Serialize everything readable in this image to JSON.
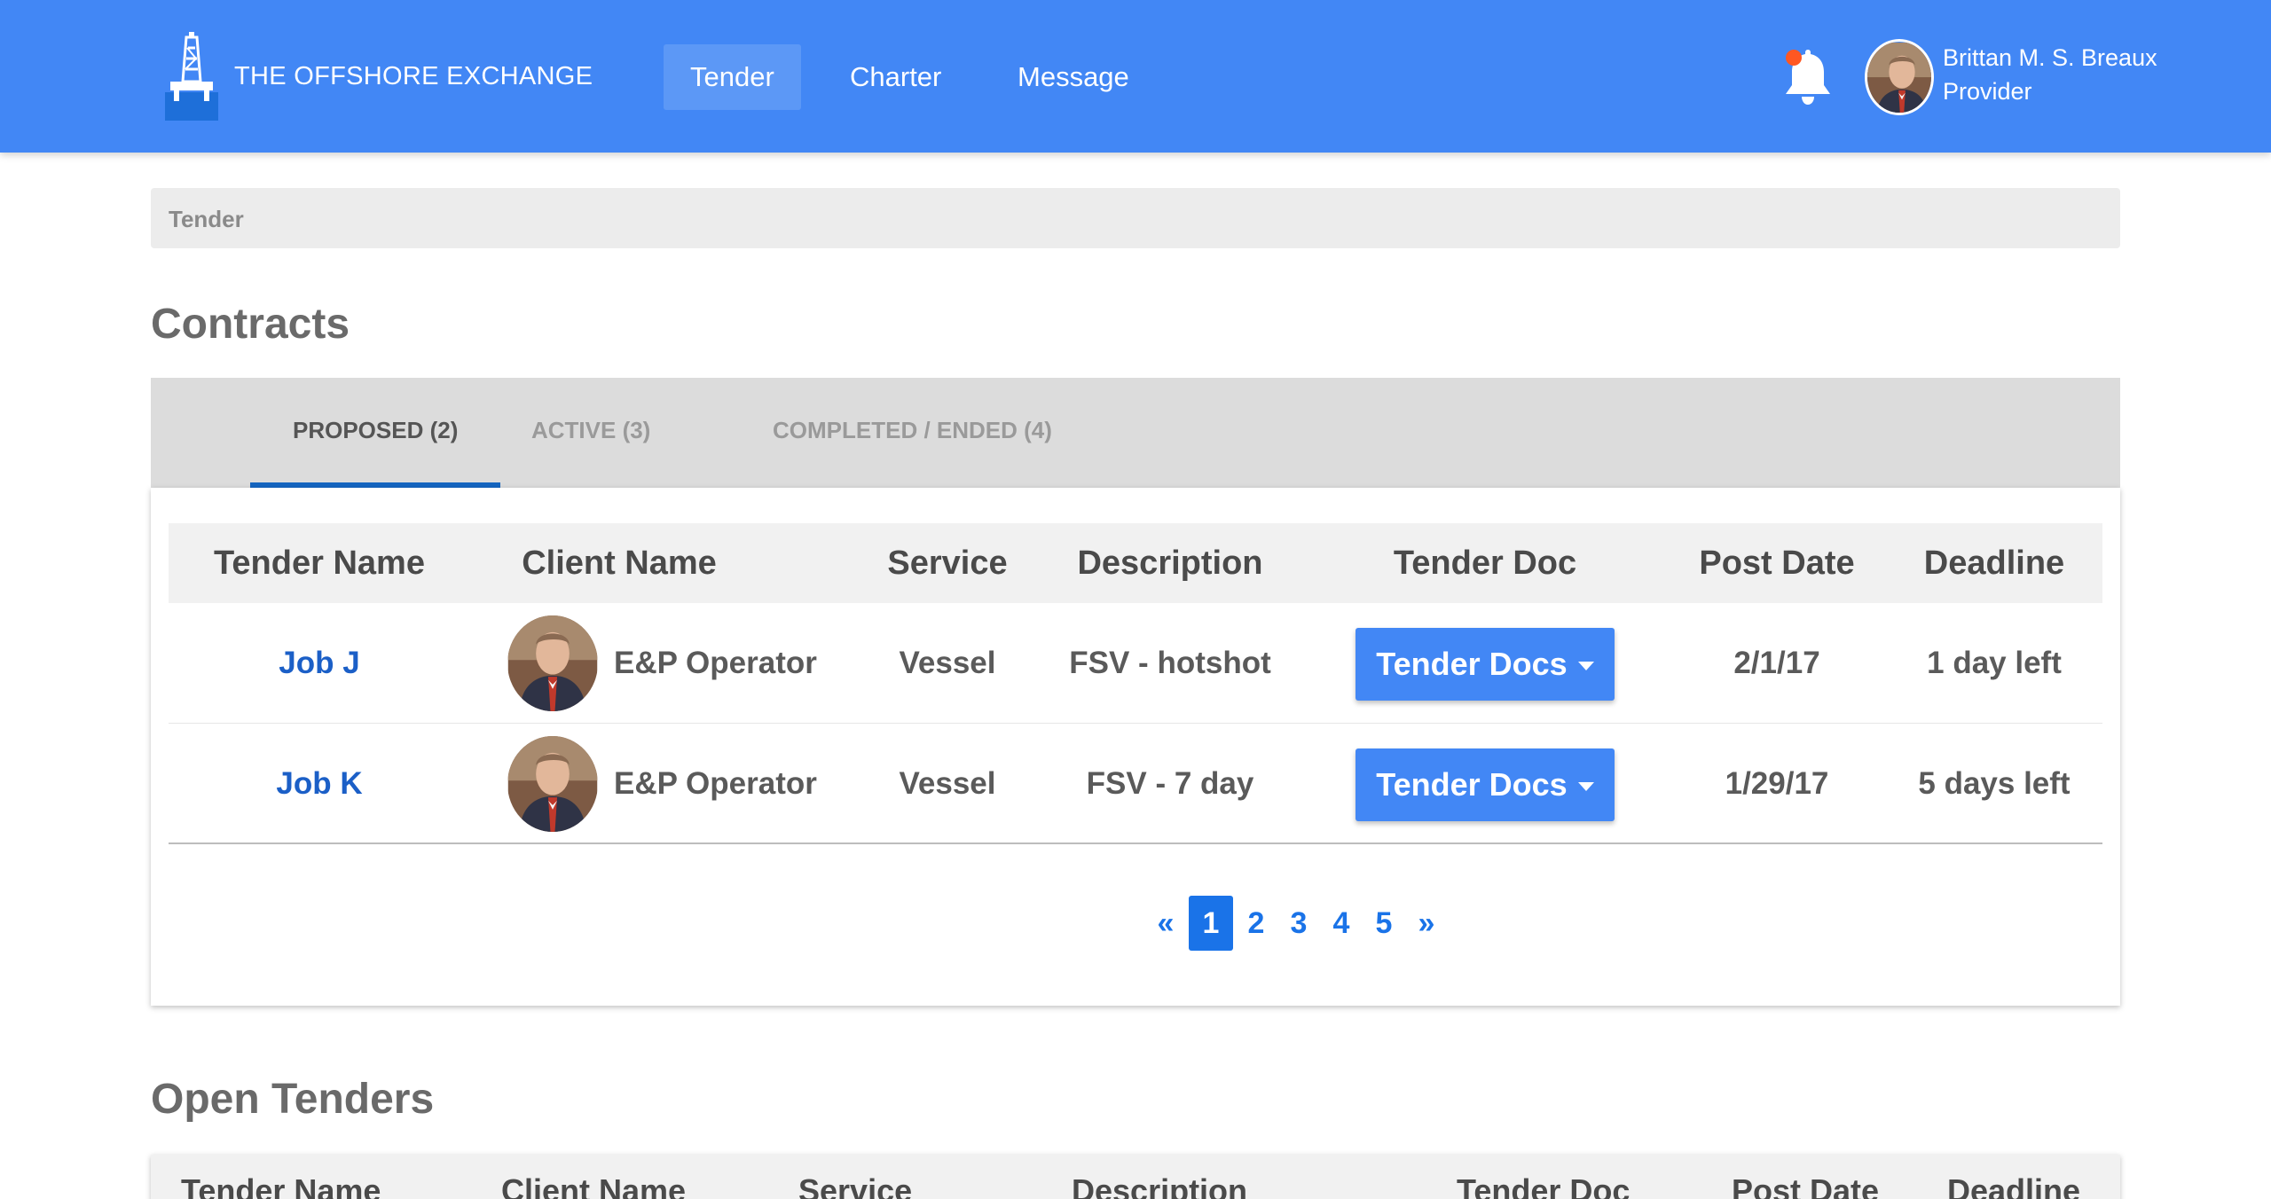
{
  "brand": {
    "name": "THE OFFSHORE EXCHANGE",
    "logo_icon": "oil-rig-icon"
  },
  "nav": {
    "tender": "Tender",
    "charter": "Charter",
    "message": "Message"
  },
  "user": {
    "name": "Brittan M. S. Breaux",
    "role": "Provider"
  },
  "notification": {
    "icon": "bell-icon",
    "dot_color": "#ff5722"
  },
  "breadcrumb": {
    "current": "Tender"
  },
  "contracts": {
    "title": "Contracts",
    "tabs": [
      {
        "label": "PROPOSED (2)"
      },
      {
        "label": "ACTIVE (3)"
      },
      {
        "label": "COMPLETED / ENDED (4)"
      }
    ],
    "columns": [
      "Tender Name",
      "Client Name",
      "Service",
      "Description",
      "Tender Doc",
      "Post Date",
      "Deadline"
    ],
    "rows": [
      {
        "tender_name": "Job J",
        "client_name": "E&P Operator",
        "service": "Vessel",
        "description": "FSV - hotshot",
        "tender_doc": "Tender Docs",
        "post_date": "2/1/17",
        "deadline": "1 day left"
      },
      {
        "tender_name": "Job K",
        "client_name": "E&P Operator",
        "service": "Vessel",
        "description": "FSV - 7 day",
        "tender_doc": "Tender Docs",
        "post_date": "1/29/17",
        "deadline": "5 days left"
      }
    ],
    "pagination": {
      "prev": "«",
      "pages": [
        "1",
        "2",
        "3",
        "4",
        "5"
      ],
      "current": "1",
      "next": "»"
    }
  },
  "open_tenders": {
    "title": "Open Tenders",
    "columns": [
      "Tender Name",
      "Client Name",
      "Service",
      "Description",
      "Tender Doc",
      "Post Date",
      "Deadline"
    ]
  },
  "colors": {
    "primary": "#4287f5",
    "link": "#1b5fc7",
    "tab_underline": "#1565c0",
    "pagination": "#1a73e8"
  }
}
